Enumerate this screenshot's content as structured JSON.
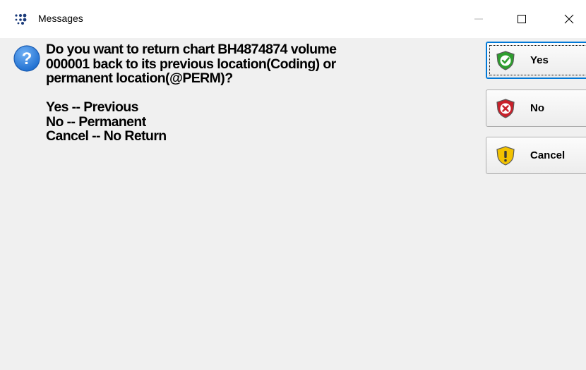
{
  "window": {
    "title": "Messages",
    "icons": {
      "app": "app-dots-icon",
      "minimize": "minimize-icon",
      "maximize": "maximize-icon",
      "close": "close-icon"
    }
  },
  "message": {
    "icon": "question-icon",
    "lines": [
      "Do you want to return chart BH4874874 volume",
      "000001 back to its previous location(Coding) or",
      "permanent location(@PERM)?",
      "Yes -- Previous",
      "No -- Permanent",
      "Cancel -- No Return"
    ]
  },
  "buttons": {
    "yes": {
      "label": "Yes",
      "icon": "shield-check-icon",
      "color": "#2e9e2e"
    },
    "no": {
      "label": "No",
      "icon": "shield-x-icon",
      "color": "#c8202a"
    },
    "cancel": {
      "label": "Cancel",
      "icon": "shield-warning-icon",
      "color": "#f2c200"
    }
  },
  "colors": {
    "titlebar": "#ffffff",
    "background": "#f0f0f0",
    "default_button_border": "#0078d7",
    "question_icon": "#1f6fd0"
  }
}
